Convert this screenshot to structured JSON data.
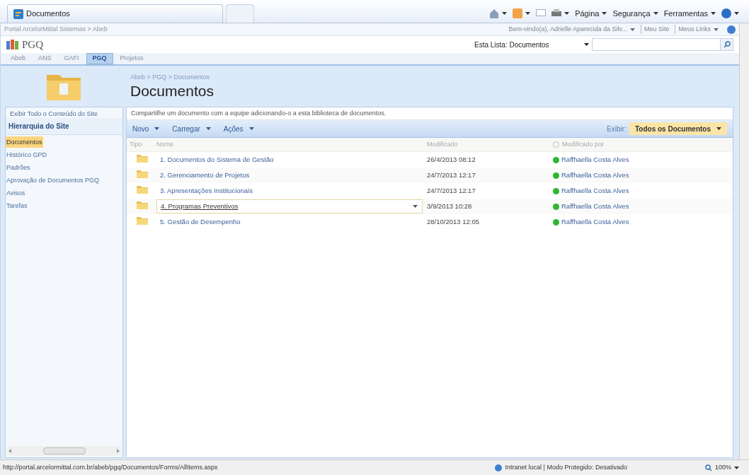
{
  "browser": {
    "tab_title": "Documentos",
    "menus": [
      "Página",
      "Segurança",
      "Ferramentas"
    ]
  },
  "top_bar": {
    "breadcrumb": "Portal ArcelorMittal Sistemas > Abeb",
    "welcome": "Bem-vindo(a), Adrielle Aparecida da Silv...",
    "links": [
      "Meu Site",
      "Meus Links"
    ]
  },
  "site": {
    "title": "PGQ",
    "search_scope": "Esta Lista: Documentos"
  },
  "top_tabs": [
    {
      "label": "Abeb",
      "selected": false
    },
    {
      "label": "ANS",
      "selected": false
    },
    {
      "label": "GAFI",
      "selected": false
    },
    {
      "label": "PGQ",
      "selected": true
    },
    {
      "label": "Projetos",
      "selected": false
    }
  ],
  "page": {
    "breadcrumb": "Abeb > PGQ > Documentos",
    "title": "Documentos",
    "description": "Compartilhe um documento com a equipe adicionando-o a esta biblioteca de documentos."
  },
  "sidebar": {
    "view_all": "Exibir Todo o Conteúdo do Site",
    "heading": "Hierarquia do Site",
    "items": [
      {
        "label": "Documentos",
        "selected": true
      },
      {
        "label": "Histórico GPD",
        "selected": false
      },
      {
        "label": "Padrões",
        "selected": false
      },
      {
        "label": "Aprovação de Documentos PGQ",
        "selected": false
      },
      {
        "label": "Avisos",
        "selected": false
      },
      {
        "label": "Tarefas",
        "selected": false
      }
    ]
  },
  "toolbar": {
    "menus": [
      "Novo",
      "Carregar",
      "Ações"
    ],
    "view_label": "Exibir:",
    "view": "Todos os Documentos"
  },
  "table": {
    "columns": [
      "Tipo",
      "Nome",
      "Modificado",
      "Modificado por"
    ],
    "rows": [
      {
        "name": "1. Documentos do Sistema de Gestão",
        "modified": "26/4/2013 08:12",
        "modified_by": "Raffhaella Costa Alves",
        "selected": false
      },
      {
        "name": "2. Gerenciamento de Projetos",
        "modified": "24/7/2013 12:17",
        "modified_by": "Raffhaella Costa Alves",
        "selected": false
      },
      {
        "name": "3. Apresentações Institucionais",
        "modified": "24/7/2013 12:17",
        "modified_by": "Raffhaella Costa Alves",
        "selected": false
      },
      {
        "name": "4. Programas Preventivos",
        "modified": "3/9/2013 10:28",
        "modified_by": "Raffhaella Costa Alves",
        "selected": true
      },
      {
        "name": "5. Gestão de Desempenho",
        "modified": "28/10/2013 12:05",
        "modified_by": "Raffhaella Costa Alves",
        "selected": false
      }
    ]
  },
  "status_bar": {
    "url": "http://portal.arcelormittal.com.br/abeb/pgq/Documentos/Forms/AllItems.aspx",
    "zone": "Intranet local | Modo Protegido: Desativado",
    "zoom": "100%"
  }
}
